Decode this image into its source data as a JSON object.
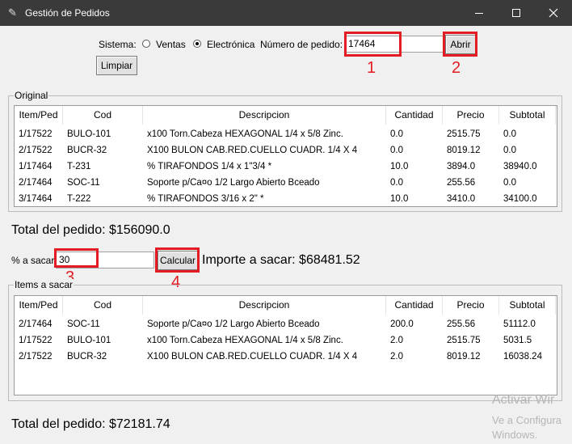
{
  "window": {
    "title": "Gestión de Pedidos"
  },
  "top": {
    "sistema_label": "Sistema:",
    "radio_ventas": "Ventas",
    "radio_electronica": "Electrónica",
    "selected_sistema": "Electrónica",
    "pedido_label": "Número de pedido:",
    "pedido_value": "17464",
    "abrir_label": "Abrir",
    "limpiar_label": "Limpiar"
  },
  "original": {
    "title": "Original",
    "columns": [
      "Item/Ped",
      "Cod",
      "Descripcion",
      "Cantidad",
      "Precio",
      "Subtotal"
    ],
    "rows": [
      [
        "1/17522",
        "BULO-101",
        "x100 Torn.Cabeza HEXAGONAL 1/4 x 5/8    Zinc.",
        "0.0",
        "2515.75",
        "0.0"
      ],
      [
        "2/17522",
        "BUCR-32",
        "X100 BULON CAB.RED.CUELLO CUADR. 1/4 X 4",
        "0.0",
        "8019.12",
        "0.0"
      ],
      [
        "1/17464",
        "T-231",
        "% TIRAFONDOS 1/4 x 1\"3/4 *",
        "10.0",
        "3894.0",
        "38940.0"
      ],
      [
        "2/17464",
        "SOC-11",
        "Soporte p/Ca¤o 1/2 Largo Abierto Bceado",
        "0.0",
        "255.56",
        "0.0"
      ],
      [
        "3/17464",
        "T-222",
        "% TIRAFONDOS 3/16 x 2\" *",
        "10.0",
        "3410.0",
        "34100.0"
      ]
    ]
  },
  "total_pedido": "Total del pedido: $156090.0",
  "sacar": {
    "pct_label": "% a sacar:",
    "pct_value": "30",
    "calcular_label": "Calcular",
    "importe_text": "Importe a sacar: $68481.52"
  },
  "items_sacar": {
    "title": "Items a sacar",
    "columns": [
      "Item/Ped",
      "Cod",
      "Descripcion",
      "Cantidad",
      "Precio",
      "Subtotal"
    ],
    "rows": [
      [
        "2/17464",
        "SOC-11",
        "Soporte p/Ca¤o 1/2 Largo Abierto Bceado",
        "200.0",
        "255.56",
        "51112.0"
      ],
      [
        "1/17522",
        "BULO-101",
        "x100 Torn.Cabeza HEXAGONAL 1/4 x 5/8    Zinc.",
        "2.0",
        "2515.75",
        "5031.5"
      ],
      [
        "2/17522",
        "BUCR-32",
        "X100 BULON CAB.RED.CUELLO CUADR. 1/4 X 4",
        "2.0",
        "8019.12",
        "16038.24"
      ]
    ]
  },
  "total_final": "Total del pedido: $72181.74",
  "annotations": {
    "n1": "1",
    "n2": "2",
    "n3": "3",
    "n4": "4",
    "color": "#e31c23"
  },
  "watermark": {
    "line1": "Activar Wir",
    "line2": "Ve a Configura",
    "line3": "Windows."
  }
}
